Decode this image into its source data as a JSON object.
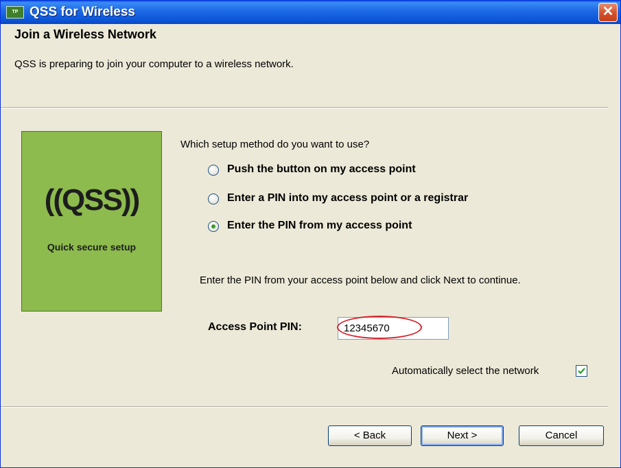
{
  "window": {
    "title": "QSS for Wireless",
    "icon_name": "app-icon",
    "close_label": "✕"
  },
  "header": {
    "heading": "Join a Wireless Network",
    "subtext": "QSS is preparing to join your computer to a wireless network."
  },
  "logo": {
    "main_text": "((QSS))",
    "sub_text": "Quick secure setup"
  },
  "setup": {
    "question": "Which setup method do you want to use?",
    "options": [
      {
        "label": "Push the button on my access point",
        "selected": false
      },
      {
        "label": "Enter a PIN into my access point or a registrar",
        "selected": false
      },
      {
        "label": "Enter the PIN from my access point",
        "selected": true
      }
    ],
    "instruction": "Enter the PIN from your access point below and click Next to continue.",
    "pin_label": "Access Point PIN:",
    "pin_value": "12345670",
    "auto_select_label": "Automatically select the network",
    "auto_select_checked": true
  },
  "buttons": {
    "back": "< Back",
    "next": "Next >",
    "cancel": "Cancel"
  },
  "colors": {
    "title_bar": "#0a57e0",
    "logo_background": "#8dbb4e",
    "highlight": "#d9232b"
  }
}
